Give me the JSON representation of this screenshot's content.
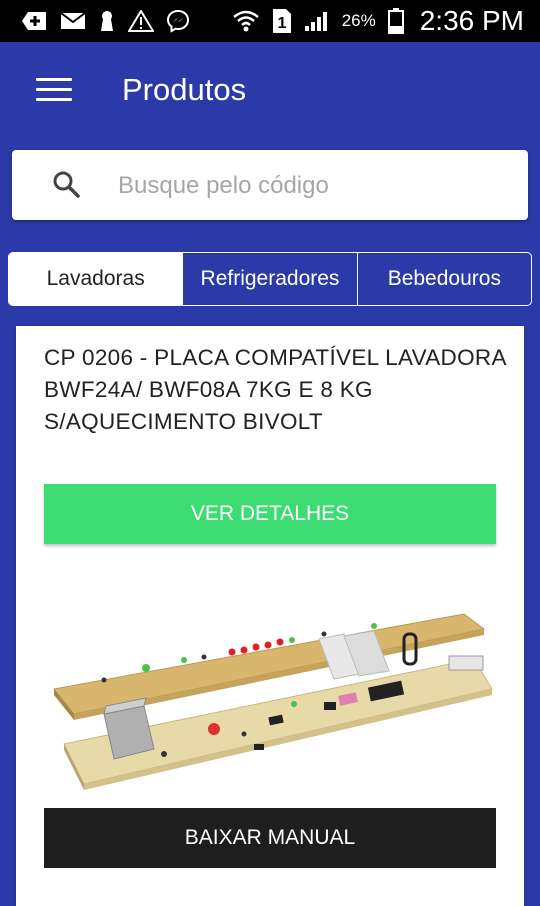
{
  "status_bar": {
    "battery": "26%",
    "time": "2:36 PM",
    "sim_slot": "1",
    "icons": [
      "add-icon",
      "mail-icon",
      "keyhole-icon",
      "warning-icon",
      "messenger-icon",
      "wifi-icon",
      "sim-icon",
      "signal-icon",
      "battery-icon"
    ]
  },
  "toolbar": {
    "title": "Produtos",
    "menu_icon": "hamburger-menu-icon"
  },
  "search": {
    "placeholder": "Busque pelo código",
    "value": "",
    "icon": "search-icon"
  },
  "tabs": [
    {
      "label": "Lavadoras",
      "active": true
    },
    {
      "label": "Refrigeradores",
      "active": false
    },
    {
      "label": "Bebedouros",
      "active": false
    }
  ],
  "product": {
    "title": "CP 0206 - PLACA COMPATÍVEL LAVADORA BWF24A/ BWF08A 7KG E 8 KG S/AQUECIMENTO BIVOLT",
    "details_label": "VER DETALHES",
    "manual_label": "BAIXAR MANUAL",
    "image": "circuit-board-image"
  },
  "colors": {
    "primary": "#2b3aa8",
    "accent_green": "#3cdc72",
    "dark_button": "#1e1e1e"
  }
}
